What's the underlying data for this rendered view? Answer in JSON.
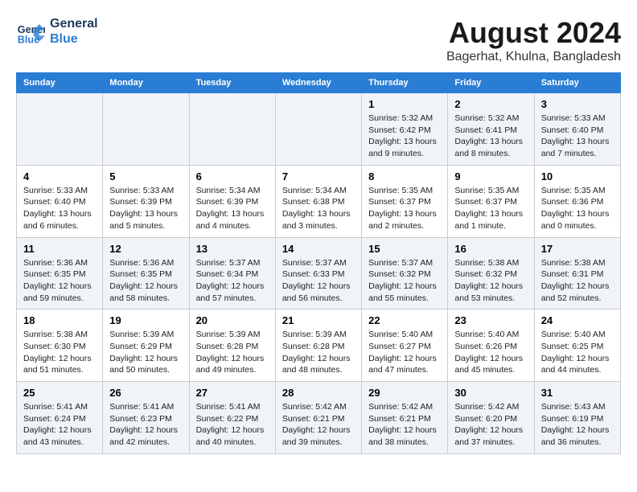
{
  "logo": {
    "name_line1": "General",
    "name_line2": "Blue"
  },
  "title": "August 2024",
  "subtitle": "Bagerhat, Khulna, Bangladesh",
  "header_days": [
    "Sunday",
    "Monday",
    "Tuesday",
    "Wednesday",
    "Thursday",
    "Friday",
    "Saturday"
  ],
  "weeks": [
    [
      {
        "day": "",
        "info": ""
      },
      {
        "day": "",
        "info": ""
      },
      {
        "day": "",
        "info": ""
      },
      {
        "day": "",
        "info": ""
      },
      {
        "day": "1",
        "info": "Sunrise: 5:32 AM\nSunset: 6:42 PM\nDaylight: 13 hours\nand 9 minutes."
      },
      {
        "day": "2",
        "info": "Sunrise: 5:32 AM\nSunset: 6:41 PM\nDaylight: 13 hours\nand 8 minutes."
      },
      {
        "day": "3",
        "info": "Sunrise: 5:33 AM\nSunset: 6:40 PM\nDaylight: 13 hours\nand 7 minutes."
      }
    ],
    [
      {
        "day": "4",
        "info": "Sunrise: 5:33 AM\nSunset: 6:40 PM\nDaylight: 13 hours\nand 6 minutes."
      },
      {
        "day": "5",
        "info": "Sunrise: 5:33 AM\nSunset: 6:39 PM\nDaylight: 13 hours\nand 5 minutes."
      },
      {
        "day": "6",
        "info": "Sunrise: 5:34 AM\nSunset: 6:39 PM\nDaylight: 13 hours\nand 4 minutes."
      },
      {
        "day": "7",
        "info": "Sunrise: 5:34 AM\nSunset: 6:38 PM\nDaylight: 13 hours\nand 3 minutes."
      },
      {
        "day": "8",
        "info": "Sunrise: 5:35 AM\nSunset: 6:37 PM\nDaylight: 13 hours\nand 2 minutes."
      },
      {
        "day": "9",
        "info": "Sunrise: 5:35 AM\nSunset: 6:37 PM\nDaylight: 13 hours\nand 1 minute."
      },
      {
        "day": "10",
        "info": "Sunrise: 5:35 AM\nSunset: 6:36 PM\nDaylight: 13 hours\nand 0 minutes."
      }
    ],
    [
      {
        "day": "11",
        "info": "Sunrise: 5:36 AM\nSunset: 6:35 PM\nDaylight: 12 hours\nand 59 minutes."
      },
      {
        "day": "12",
        "info": "Sunrise: 5:36 AM\nSunset: 6:35 PM\nDaylight: 12 hours\nand 58 minutes."
      },
      {
        "day": "13",
        "info": "Sunrise: 5:37 AM\nSunset: 6:34 PM\nDaylight: 12 hours\nand 57 minutes."
      },
      {
        "day": "14",
        "info": "Sunrise: 5:37 AM\nSunset: 6:33 PM\nDaylight: 12 hours\nand 56 minutes."
      },
      {
        "day": "15",
        "info": "Sunrise: 5:37 AM\nSunset: 6:32 PM\nDaylight: 12 hours\nand 55 minutes."
      },
      {
        "day": "16",
        "info": "Sunrise: 5:38 AM\nSunset: 6:32 PM\nDaylight: 12 hours\nand 53 minutes."
      },
      {
        "day": "17",
        "info": "Sunrise: 5:38 AM\nSunset: 6:31 PM\nDaylight: 12 hours\nand 52 minutes."
      }
    ],
    [
      {
        "day": "18",
        "info": "Sunrise: 5:38 AM\nSunset: 6:30 PM\nDaylight: 12 hours\nand 51 minutes."
      },
      {
        "day": "19",
        "info": "Sunrise: 5:39 AM\nSunset: 6:29 PM\nDaylight: 12 hours\nand 50 minutes."
      },
      {
        "day": "20",
        "info": "Sunrise: 5:39 AM\nSunset: 6:28 PM\nDaylight: 12 hours\nand 49 minutes."
      },
      {
        "day": "21",
        "info": "Sunrise: 5:39 AM\nSunset: 6:28 PM\nDaylight: 12 hours\nand 48 minutes."
      },
      {
        "day": "22",
        "info": "Sunrise: 5:40 AM\nSunset: 6:27 PM\nDaylight: 12 hours\nand 47 minutes."
      },
      {
        "day": "23",
        "info": "Sunrise: 5:40 AM\nSunset: 6:26 PM\nDaylight: 12 hours\nand 45 minutes."
      },
      {
        "day": "24",
        "info": "Sunrise: 5:40 AM\nSunset: 6:25 PM\nDaylight: 12 hours\nand 44 minutes."
      }
    ],
    [
      {
        "day": "25",
        "info": "Sunrise: 5:41 AM\nSunset: 6:24 PM\nDaylight: 12 hours\nand 43 minutes."
      },
      {
        "day": "26",
        "info": "Sunrise: 5:41 AM\nSunset: 6:23 PM\nDaylight: 12 hours\nand 42 minutes."
      },
      {
        "day": "27",
        "info": "Sunrise: 5:41 AM\nSunset: 6:22 PM\nDaylight: 12 hours\nand 40 minutes."
      },
      {
        "day": "28",
        "info": "Sunrise: 5:42 AM\nSunset: 6:21 PM\nDaylight: 12 hours\nand 39 minutes."
      },
      {
        "day": "29",
        "info": "Sunrise: 5:42 AM\nSunset: 6:21 PM\nDaylight: 12 hours\nand 38 minutes."
      },
      {
        "day": "30",
        "info": "Sunrise: 5:42 AM\nSunset: 6:20 PM\nDaylight: 12 hours\nand 37 minutes."
      },
      {
        "day": "31",
        "info": "Sunrise: 5:43 AM\nSunset: 6:19 PM\nDaylight: 12 hours\nand 36 minutes."
      }
    ]
  ]
}
